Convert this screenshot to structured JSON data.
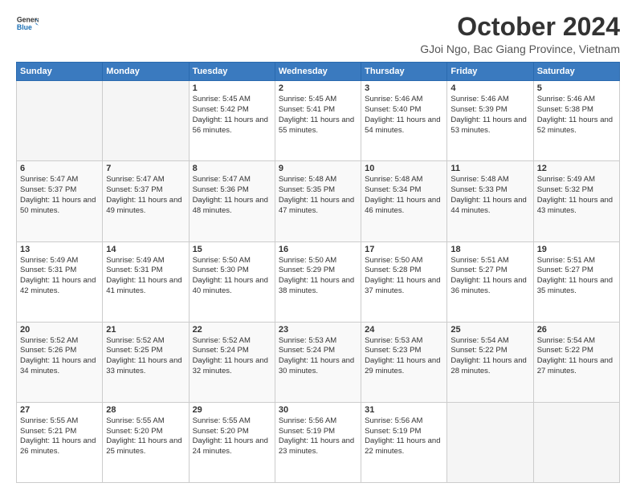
{
  "header": {
    "logo_line1": "General",
    "logo_line2": "Blue",
    "month": "October 2024",
    "location": "GJoi Ngo, Bac Giang Province, Vietnam"
  },
  "days_of_week": [
    "Sunday",
    "Monday",
    "Tuesday",
    "Wednesday",
    "Thursday",
    "Friday",
    "Saturday"
  ],
  "weeks": [
    [
      {
        "day": "",
        "empty": true
      },
      {
        "day": "",
        "empty": true
      },
      {
        "day": "1",
        "sunrise": "Sunrise: 5:45 AM",
        "sunset": "Sunset: 5:42 PM",
        "daylight": "Daylight: 11 hours and 56 minutes."
      },
      {
        "day": "2",
        "sunrise": "Sunrise: 5:45 AM",
        "sunset": "Sunset: 5:41 PM",
        "daylight": "Daylight: 11 hours and 55 minutes."
      },
      {
        "day": "3",
        "sunrise": "Sunrise: 5:46 AM",
        "sunset": "Sunset: 5:40 PM",
        "daylight": "Daylight: 11 hours and 54 minutes."
      },
      {
        "day": "4",
        "sunrise": "Sunrise: 5:46 AM",
        "sunset": "Sunset: 5:39 PM",
        "daylight": "Daylight: 11 hours and 53 minutes."
      },
      {
        "day": "5",
        "sunrise": "Sunrise: 5:46 AM",
        "sunset": "Sunset: 5:38 PM",
        "daylight": "Daylight: 11 hours and 52 minutes."
      }
    ],
    [
      {
        "day": "6",
        "sunrise": "Sunrise: 5:47 AM",
        "sunset": "Sunset: 5:37 PM",
        "daylight": "Daylight: 11 hours and 50 minutes."
      },
      {
        "day": "7",
        "sunrise": "Sunrise: 5:47 AM",
        "sunset": "Sunset: 5:37 PM",
        "daylight": "Daylight: 11 hours and 49 minutes."
      },
      {
        "day": "8",
        "sunrise": "Sunrise: 5:47 AM",
        "sunset": "Sunset: 5:36 PM",
        "daylight": "Daylight: 11 hours and 48 minutes."
      },
      {
        "day": "9",
        "sunrise": "Sunrise: 5:48 AM",
        "sunset": "Sunset: 5:35 PM",
        "daylight": "Daylight: 11 hours and 47 minutes."
      },
      {
        "day": "10",
        "sunrise": "Sunrise: 5:48 AM",
        "sunset": "Sunset: 5:34 PM",
        "daylight": "Daylight: 11 hours and 46 minutes."
      },
      {
        "day": "11",
        "sunrise": "Sunrise: 5:48 AM",
        "sunset": "Sunset: 5:33 PM",
        "daylight": "Daylight: 11 hours and 44 minutes."
      },
      {
        "day": "12",
        "sunrise": "Sunrise: 5:49 AM",
        "sunset": "Sunset: 5:32 PM",
        "daylight": "Daylight: 11 hours and 43 minutes."
      }
    ],
    [
      {
        "day": "13",
        "sunrise": "Sunrise: 5:49 AM",
        "sunset": "Sunset: 5:31 PM",
        "daylight": "Daylight: 11 hours and 42 minutes."
      },
      {
        "day": "14",
        "sunrise": "Sunrise: 5:49 AM",
        "sunset": "Sunset: 5:31 PM",
        "daylight": "Daylight: 11 hours and 41 minutes."
      },
      {
        "day": "15",
        "sunrise": "Sunrise: 5:50 AM",
        "sunset": "Sunset: 5:30 PM",
        "daylight": "Daylight: 11 hours and 40 minutes."
      },
      {
        "day": "16",
        "sunrise": "Sunrise: 5:50 AM",
        "sunset": "Sunset: 5:29 PM",
        "daylight": "Daylight: 11 hours and 38 minutes."
      },
      {
        "day": "17",
        "sunrise": "Sunrise: 5:50 AM",
        "sunset": "Sunset: 5:28 PM",
        "daylight": "Daylight: 11 hours and 37 minutes."
      },
      {
        "day": "18",
        "sunrise": "Sunrise: 5:51 AM",
        "sunset": "Sunset: 5:27 PM",
        "daylight": "Daylight: 11 hours and 36 minutes."
      },
      {
        "day": "19",
        "sunrise": "Sunrise: 5:51 AM",
        "sunset": "Sunset: 5:27 PM",
        "daylight": "Daylight: 11 hours and 35 minutes."
      }
    ],
    [
      {
        "day": "20",
        "sunrise": "Sunrise: 5:52 AM",
        "sunset": "Sunset: 5:26 PM",
        "daylight": "Daylight: 11 hours and 34 minutes."
      },
      {
        "day": "21",
        "sunrise": "Sunrise: 5:52 AM",
        "sunset": "Sunset: 5:25 PM",
        "daylight": "Daylight: 11 hours and 33 minutes."
      },
      {
        "day": "22",
        "sunrise": "Sunrise: 5:52 AM",
        "sunset": "Sunset: 5:24 PM",
        "daylight": "Daylight: 11 hours and 32 minutes."
      },
      {
        "day": "23",
        "sunrise": "Sunrise: 5:53 AM",
        "sunset": "Sunset: 5:24 PM",
        "daylight": "Daylight: 11 hours and 30 minutes."
      },
      {
        "day": "24",
        "sunrise": "Sunrise: 5:53 AM",
        "sunset": "Sunset: 5:23 PM",
        "daylight": "Daylight: 11 hours and 29 minutes."
      },
      {
        "day": "25",
        "sunrise": "Sunrise: 5:54 AM",
        "sunset": "Sunset: 5:22 PM",
        "daylight": "Daylight: 11 hours and 28 minutes."
      },
      {
        "day": "26",
        "sunrise": "Sunrise: 5:54 AM",
        "sunset": "Sunset: 5:22 PM",
        "daylight": "Daylight: 11 hours and 27 minutes."
      }
    ],
    [
      {
        "day": "27",
        "sunrise": "Sunrise: 5:55 AM",
        "sunset": "Sunset: 5:21 PM",
        "daylight": "Daylight: 11 hours and 26 minutes."
      },
      {
        "day": "28",
        "sunrise": "Sunrise: 5:55 AM",
        "sunset": "Sunset: 5:20 PM",
        "daylight": "Daylight: 11 hours and 25 minutes."
      },
      {
        "day": "29",
        "sunrise": "Sunrise: 5:55 AM",
        "sunset": "Sunset: 5:20 PM",
        "daylight": "Daylight: 11 hours and 24 minutes."
      },
      {
        "day": "30",
        "sunrise": "Sunrise: 5:56 AM",
        "sunset": "Sunset: 5:19 PM",
        "daylight": "Daylight: 11 hours and 23 minutes."
      },
      {
        "day": "31",
        "sunrise": "Sunrise: 5:56 AM",
        "sunset": "Sunset: 5:19 PM",
        "daylight": "Daylight: 11 hours and 22 minutes."
      },
      {
        "day": "",
        "empty": true
      },
      {
        "day": "",
        "empty": true
      }
    ]
  ]
}
